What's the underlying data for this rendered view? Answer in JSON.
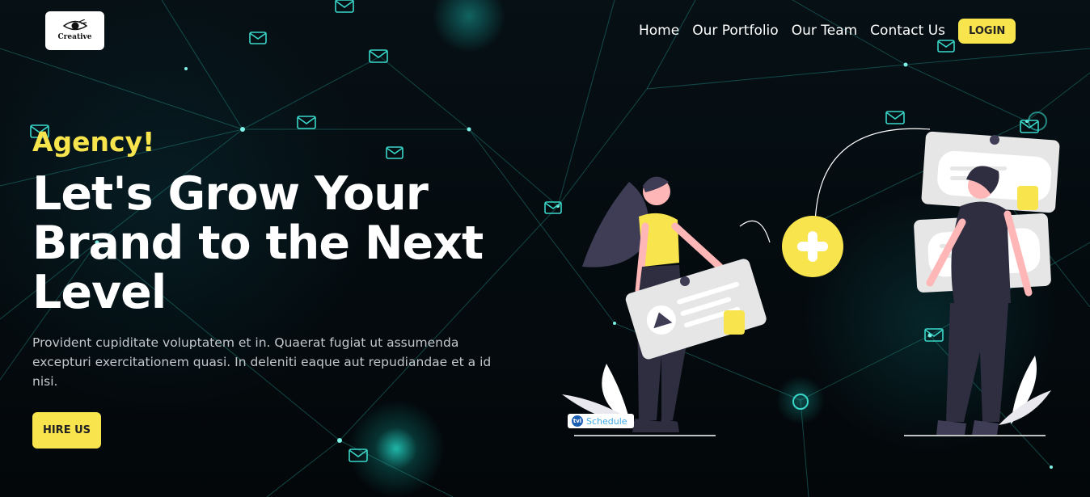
{
  "brand": {
    "logo_text": "Creative"
  },
  "nav": {
    "items": [
      {
        "label": "Home"
      },
      {
        "label": "Our Portfolio"
      },
      {
        "label": "Our Team"
      },
      {
        "label": "Contact Us"
      }
    ],
    "login_label": "LOGIN"
  },
  "hero": {
    "tagline": "Agency!",
    "headline": "Let's Grow Your Brand to the Next Level",
    "description": "Provident cupiditate voluptatem et in. Quaerat fugiat ut assumenda excepturi exercitationem quasi. In deleniti eaque aut repudiandae et a id nisi.",
    "cta_label": "HIRE US"
  },
  "widget": {
    "schedule_label": "Schedule",
    "schedule_icon_text": "tvl"
  },
  "colors": {
    "accent": "#f8e44c",
    "background": "#04080c",
    "network": "#2fd6c8"
  }
}
